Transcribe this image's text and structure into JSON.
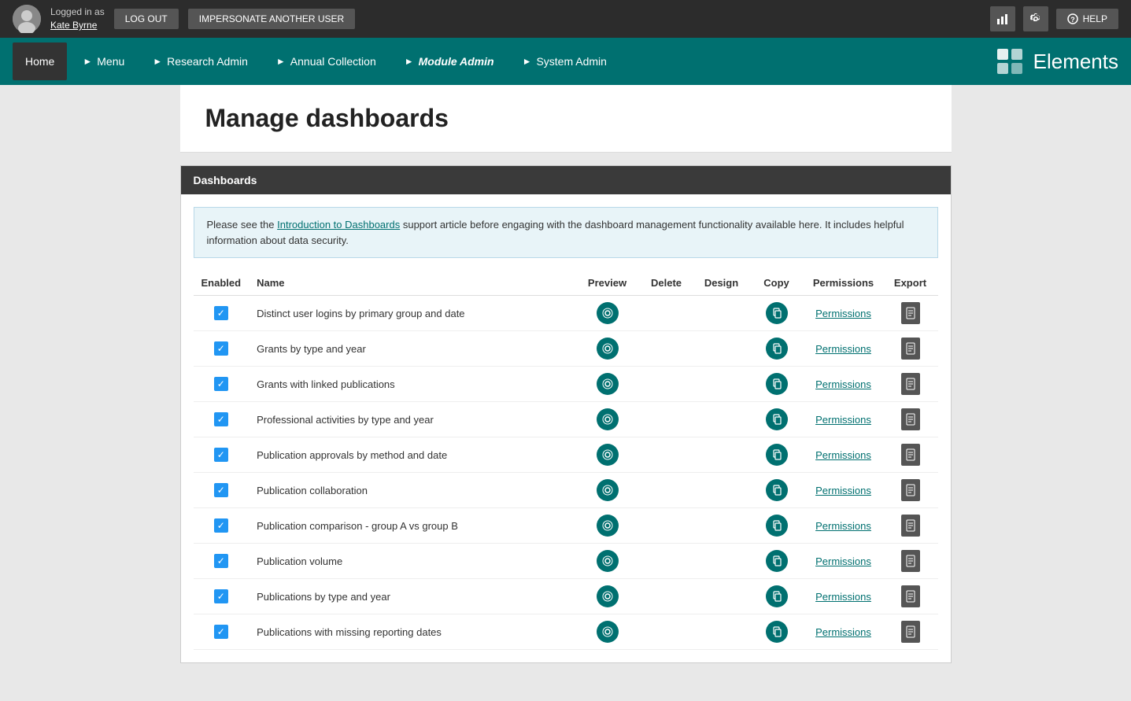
{
  "topbar": {
    "logged_in_as": "Logged in as",
    "username": "Kate Byrne",
    "logout_label": "LOG OUT",
    "impersonate_label": "IMPERSONATE ANOTHER USER",
    "help_label": "HELP"
  },
  "nav": {
    "items": [
      {
        "label": "Home",
        "active": true,
        "chevron": false,
        "italic": false
      },
      {
        "label": "Menu",
        "active": false,
        "chevron": true,
        "italic": false
      },
      {
        "label": "Research Admin",
        "active": false,
        "chevron": true,
        "italic": false
      },
      {
        "label": "Annual Collection",
        "active": false,
        "chevron": true,
        "italic": false
      },
      {
        "label": "Module Admin",
        "active": false,
        "chevron": true,
        "italic": true
      },
      {
        "label": "System Admin",
        "active": false,
        "chevron": true,
        "italic": false
      }
    ],
    "logo_text": "Elements"
  },
  "page": {
    "title": "Manage dashboards"
  },
  "section": {
    "header": "Dashboards",
    "info_text_before_link": "Please see the ",
    "info_link_text": "Introduction to Dashboards",
    "info_text_after_link": " support article before engaging with the dashboard management functionality available here. It includes helpful information about data security."
  },
  "table": {
    "columns": [
      "Enabled",
      "Name",
      "Preview",
      "Delete",
      "Design",
      "Copy",
      "Permissions",
      "Export"
    ],
    "rows": [
      {
        "enabled": true,
        "name": "Distinct user logins by primary group and date",
        "permissions": "Permissions"
      },
      {
        "enabled": true,
        "name": "Grants by type and year",
        "permissions": "Permissions"
      },
      {
        "enabled": true,
        "name": "Grants with linked publications",
        "permissions": "Permissions"
      },
      {
        "enabled": true,
        "name": "Professional activities by type and year",
        "permissions": "Permissions"
      },
      {
        "enabled": true,
        "name": "Publication approvals by method and date",
        "permissions": "Permissions"
      },
      {
        "enabled": true,
        "name": "Publication collaboration",
        "permissions": "Permissions"
      },
      {
        "enabled": true,
        "name": "Publication comparison - group A vs group B",
        "permissions": "Permissions"
      },
      {
        "enabled": true,
        "name": "Publication volume",
        "permissions": "Permissions"
      },
      {
        "enabled": true,
        "name": "Publications by type and year",
        "permissions": "Permissions"
      },
      {
        "enabled": true,
        "name": "Publications with missing reporting dates",
        "permissions": "Permissions"
      }
    ]
  }
}
